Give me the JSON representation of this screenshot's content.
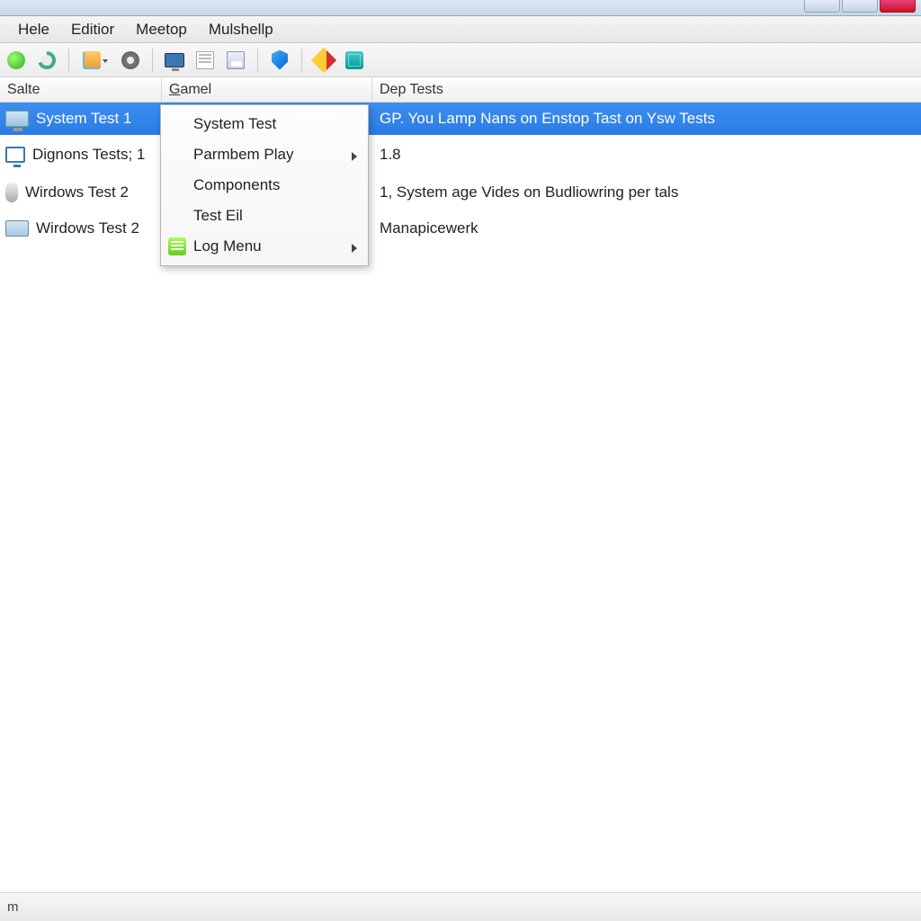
{
  "menubar": {
    "items": [
      "Hele",
      "Editior",
      "Meetop",
      "Mulshellp"
    ]
  },
  "columns": {
    "c1": "Salte",
    "c2_prefix": "G",
    "c2_rest": "amel",
    "c3": "Dep Tests"
  },
  "rows": [
    {
      "icon": "desk",
      "name": "System Test  1",
      "dep": "GP. You Lamp Nans on Enstop Tast on Ysw Tests",
      "selected": true
    },
    {
      "icon": "screen",
      "name": "Dignons Tests; 1",
      "dep": "1.8"
    },
    {
      "icon": "mic",
      "name": "Wirdows Test 2",
      "dep": "1, System age Vides on Budliowring per tals"
    },
    {
      "icon": "desk2",
      "name": "Wirdows Test 2",
      "dep": "Manapicewerk"
    }
  ],
  "context_menu": {
    "items": [
      {
        "label": "System Test",
        "submenu": false
      },
      {
        "label": "Parmbem Play",
        "submenu": true
      },
      {
        "label": "Components",
        "submenu": false
      },
      {
        "label": "Test Eil",
        "submenu": false
      },
      {
        "label": "Log Menu",
        "submenu": true,
        "icon": "log"
      }
    ]
  },
  "statusbar": {
    "text": "m"
  }
}
